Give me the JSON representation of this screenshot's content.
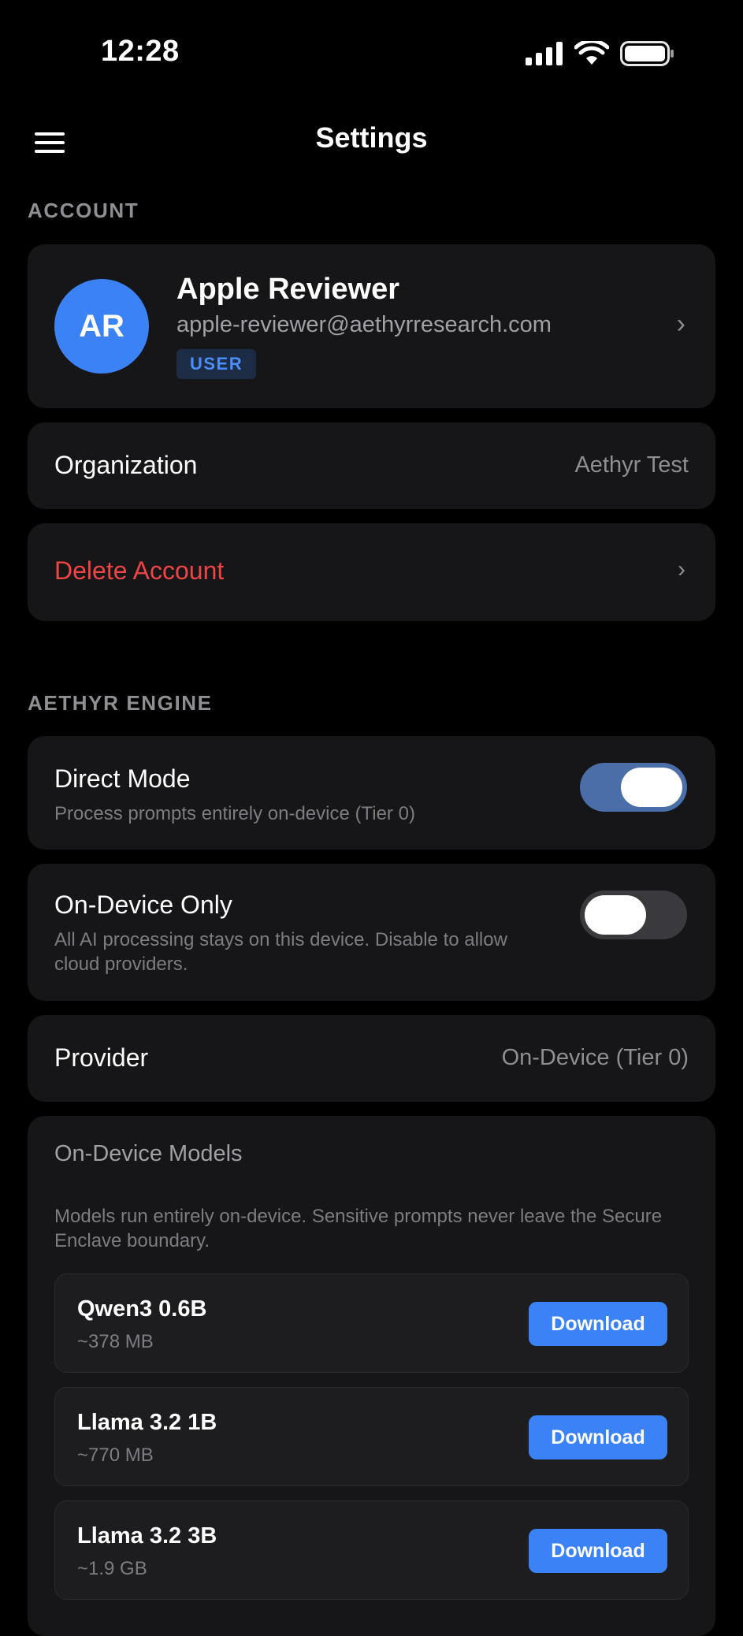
{
  "status_bar": {
    "time": "12:28",
    "signal_icon": "cellular-signal-icon",
    "wifi_icon": "wifi-icon",
    "battery_icon": "battery-icon"
  },
  "header": {
    "menu_icon": "hamburger-menu-icon",
    "title": "Settings"
  },
  "account_section": {
    "header": "ACCOUNT",
    "avatar_initials": "AR",
    "name": "Apple Reviewer",
    "email": "apple-reviewer@aethyrresearch.com",
    "role": "USER",
    "organization_label": "Organization",
    "organization_value": "Aethyr Test",
    "delete_label": "Delete Account"
  },
  "engine_section": {
    "header": "AETHYR ENGINE",
    "direct_mode": {
      "title": "Direct Mode",
      "subtitle": "Process prompts entirely on-device (Tier 0)",
      "enabled": true
    },
    "on_device_only": {
      "title": "On-Device Only",
      "subtitle": "All AI processing stays on this device. Disable to allow cloud providers.",
      "enabled": false
    },
    "provider_label": "Provider",
    "provider_value": "On-Device (Tier 0)",
    "models": {
      "title": "On-Device Models",
      "description": "Models run entirely on-device. Sensitive prompts never leave the Secure Enclave boundary.",
      "items": [
        {
          "name": "Qwen3 0.6B",
          "size": "~378 MB",
          "action": "Download"
        },
        {
          "name": "Llama 3.2 1B",
          "size": "~770 MB",
          "action": "Download"
        },
        {
          "name": "Llama 3.2 3B",
          "size": "~1.9 GB",
          "action": "Download"
        }
      ]
    }
  },
  "colors": {
    "background": "#000000",
    "card": "#161618",
    "accent": "#3b82f6",
    "danger": "#ef4444",
    "secondary_text": "#8e8e93"
  }
}
